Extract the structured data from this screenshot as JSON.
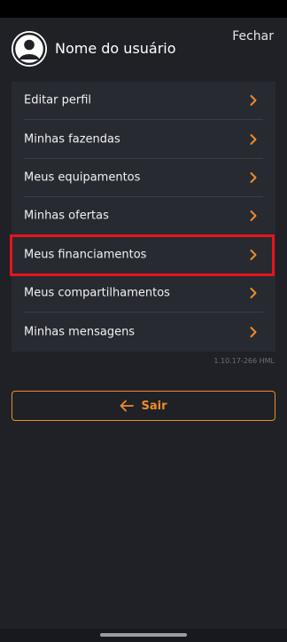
{
  "header": {
    "user_name": "Nome do usuário",
    "close_label": "Fechar",
    "avatar_icon": "user-avatar-icon"
  },
  "menu": {
    "items": [
      {
        "label": "Editar perfil"
      },
      {
        "label": "Minhas fazendas"
      },
      {
        "label": "Meus equipamentos"
      },
      {
        "label": "Minhas ofertas"
      },
      {
        "label": "Meus financiamentos",
        "highlighted": true
      },
      {
        "label": "Meus compartilhamentos"
      },
      {
        "label": "Minhas mensagens"
      }
    ],
    "chevron_icon": "chevron-right-icon"
  },
  "version": "1.10.17-266 HML",
  "logout": {
    "label": "Sair",
    "icon": "arrow-left-icon"
  },
  "colors": {
    "background": "#1f2127",
    "card": "#272a31",
    "accent": "#f08c2a",
    "highlight": "#e8141b"
  }
}
